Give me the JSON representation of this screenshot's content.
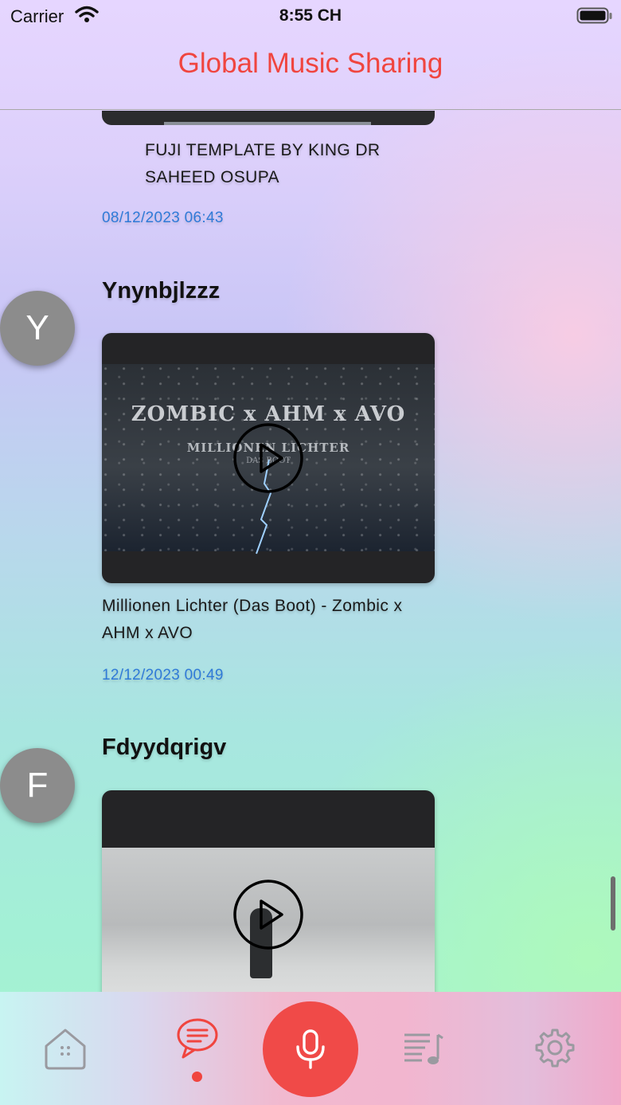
{
  "status_bar": {
    "carrier": "Carrier",
    "time": "8:55 CH"
  },
  "header": {
    "title": "Global Music Sharing"
  },
  "feed": {
    "partial_post": {
      "caption": "FUJI TEMPLATE BY KING DR SAHEED OSUPA",
      "date": "08/12/2023 06:43"
    },
    "posts": [
      {
        "avatar_initial": "Y",
        "username": "Ynynbjlzzz",
        "video_overlay_title": "ZOMBIC x AHM x AVO",
        "video_overlay_subtitle": "MILLIONEN LICHTER",
        "video_overlay_small": "DAS BOOT",
        "caption": "Millionen Lichter (Das Boot) - Zombic x AHM x AVO",
        "date": "12/12/2023 00:49"
      },
      {
        "avatar_initial": "F",
        "username": "Fdyydqrigv"
      }
    ]
  },
  "tabbar": {
    "tabs": [
      {
        "icon": "home-icon"
      },
      {
        "icon": "chat-icon",
        "selected": true
      },
      {
        "icon": "microphone-icon"
      },
      {
        "icon": "playlist-icon"
      },
      {
        "icon": "settings-icon"
      }
    ],
    "accent_color": "#f0453f"
  }
}
